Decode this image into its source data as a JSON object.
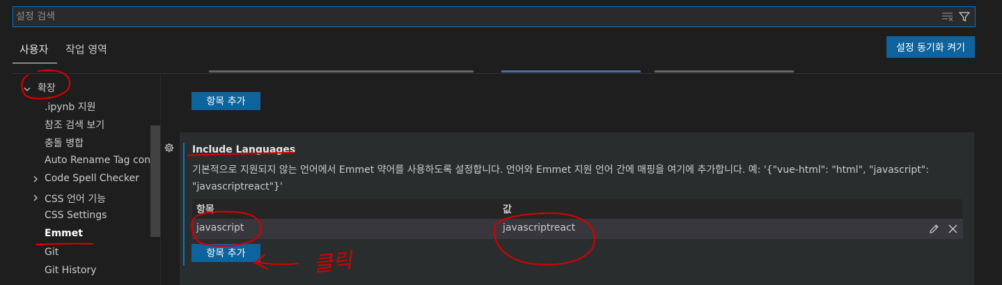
{
  "search": {
    "placeholder": "설정 검색"
  },
  "tabs": [
    {
      "label": "사용자",
      "active": true
    },
    {
      "label": "작업 영역",
      "active": false
    }
  ],
  "sync_button": {
    "label": "설정 동기화 켜기"
  },
  "toc": {
    "items": [
      {
        "label": "확장",
        "expanded": true,
        "level": 0
      },
      {
        "label": ".ipynb 지원",
        "level": 1
      },
      {
        "label": "참조 검색 보기",
        "level": 1
      },
      {
        "label": "충돌 병합",
        "level": 1
      },
      {
        "label": "Auto Rename Tag con...",
        "level": 1
      },
      {
        "label": "Code Spell Checker",
        "level": 1,
        "has_children": true
      },
      {
        "label": "CSS 언어 기능",
        "level": 1,
        "has_children": true
      },
      {
        "label": "CSS Settings",
        "level": 1
      },
      {
        "label": "Emmet",
        "level": 1,
        "selected": true
      },
      {
        "label": "Git",
        "level": 1
      },
      {
        "label": "Git History",
        "level": 1
      }
    ]
  },
  "previous_setting": {
    "add_button": "항목 추가"
  },
  "setting": {
    "title": "Include Languages",
    "description": "기본적으로 지원되지 않는 언어에서 Emmet 약어를 사용하도록 설정합니다. 언어와 Emmet 지원 언어 간에 매핑을 여기에 추가합니다. 예: '{\"vue-html\": \"html\", \"javascript\": \"javascriptreact\"}'",
    "table": {
      "headers": [
        "항목",
        "값"
      ],
      "rows": [
        {
          "key": "javascript",
          "value": "javascriptreact"
        }
      ]
    },
    "add_button": "항목 추가"
  },
  "annotation": {
    "text": "클릭",
    "color": "#d60000"
  },
  "colors": {
    "accent": "#0078d4",
    "button": "#0e639c",
    "background": "#1e1e1e",
    "panel": "#2a2d2e",
    "annotation_ink": "#d60000"
  }
}
